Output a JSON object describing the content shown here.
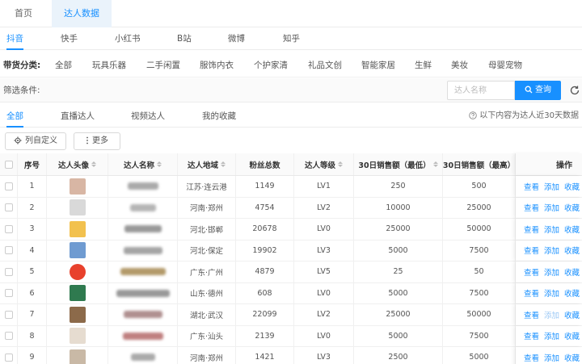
{
  "topnav": {
    "tabs": [
      {
        "label": "首页"
      },
      {
        "label": "达人数据"
      }
    ]
  },
  "platforms": [
    {
      "label": "抖音"
    },
    {
      "label": "快手"
    },
    {
      "label": "小红书"
    },
    {
      "label": "B站"
    },
    {
      "label": "微博"
    },
    {
      "label": "知乎"
    }
  ],
  "categories": {
    "label": "带货分类:",
    "items": [
      "全部",
      "玩具乐器",
      "二手闲置",
      "服饰内衣",
      "个护家清",
      "礼品文创",
      "智能家居",
      "生鲜",
      "美妆",
      "母婴宠物"
    ]
  },
  "filter": {
    "label": "筛选条件:",
    "placeholder": "达人名称",
    "search_label": "查询"
  },
  "subtabs": [
    "全部",
    "直播达人",
    "视频达人",
    "我的收藏"
  ],
  "note": "以下内容为达人近30天数据",
  "toolbar": {
    "customize_label": "列自定义",
    "more_label": "更多"
  },
  "table": {
    "headers": {
      "index": "序号",
      "avatar": "达人头像",
      "name": "达人名称",
      "region": "达人地域",
      "fans": "粉丝总数",
      "level": "达人等级",
      "sales_min": "30日销售额（最低）",
      "sales_max": "30日销售额（最高）",
      "ops": "操作"
    },
    "actions": [
      "查看",
      "添加",
      "收藏"
    ],
    "rows": [
      {
        "index": "1",
        "region": "江苏·连云港",
        "fans": "1149",
        "level": "LV1",
        "sales_min": "250",
        "sales_max": "500",
        "avatar_color": "#d8b6a4"
      },
      {
        "index": "2",
        "region": "河南·郑州",
        "fans": "4754",
        "level": "LV2",
        "sales_min": "10000",
        "sales_max": "25000",
        "avatar_color": "#d9d9d9"
      },
      {
        "index": "3",
        "region": "河北·邯郸",
        "fans": "20678",
        "level": "LV0",
        "sales_min": "25000",
        "sales_max": "50000",
        "avatar_color": "#f2c14e"
      },
      {
        "index": "4",
        "region": "河北·保定",
        "fans": "19902",
        "level": "LV3",
        "sales_min": "5000",
        "sales_max": "7500",
        "avatar_color": "#6f9bd1"
      },
      {
        "index": "5",
        "region": "广东·广州",
        "fans": "4879",
        "level": "LV5",
        "sales_min": "25",
        "sales_max": "50",
        "avatar_color": "#e8412c"
      },
      {
        "index": "6",
        "region": "山东·德州",
        "fans": "608",
        "level": "LV0",
        "sales_min": "5000",
        "sales_max": "7500",
        "avatar_color": "#2f7a4f"
      },
      {
        "index": "7",
        "region": "湖北·武汉",
        "fans": "22099",
        "level": "LV2",
        "sales_min": "25000",
        "sales_max": "50000",
        "avatar_color": "#8c6a4a"
      },
      {
        "index": "8",
        "region": "广东·汕头",
        "fans": "2139",
        "level": "LV0",
        "sales_min": "5000",
        "sales_max": "7500",
        "avatar_color": "#e6dcd0"
      },
      {
        "index": "9",
        "region": "河南·郑州",
        "fans": "1421",
        "level": "LV3",
        "sales_min": "2500",
        "sales_max": "5000",
        "avatar_color": "#c9b9a6"
      }
    ]
  }
}
